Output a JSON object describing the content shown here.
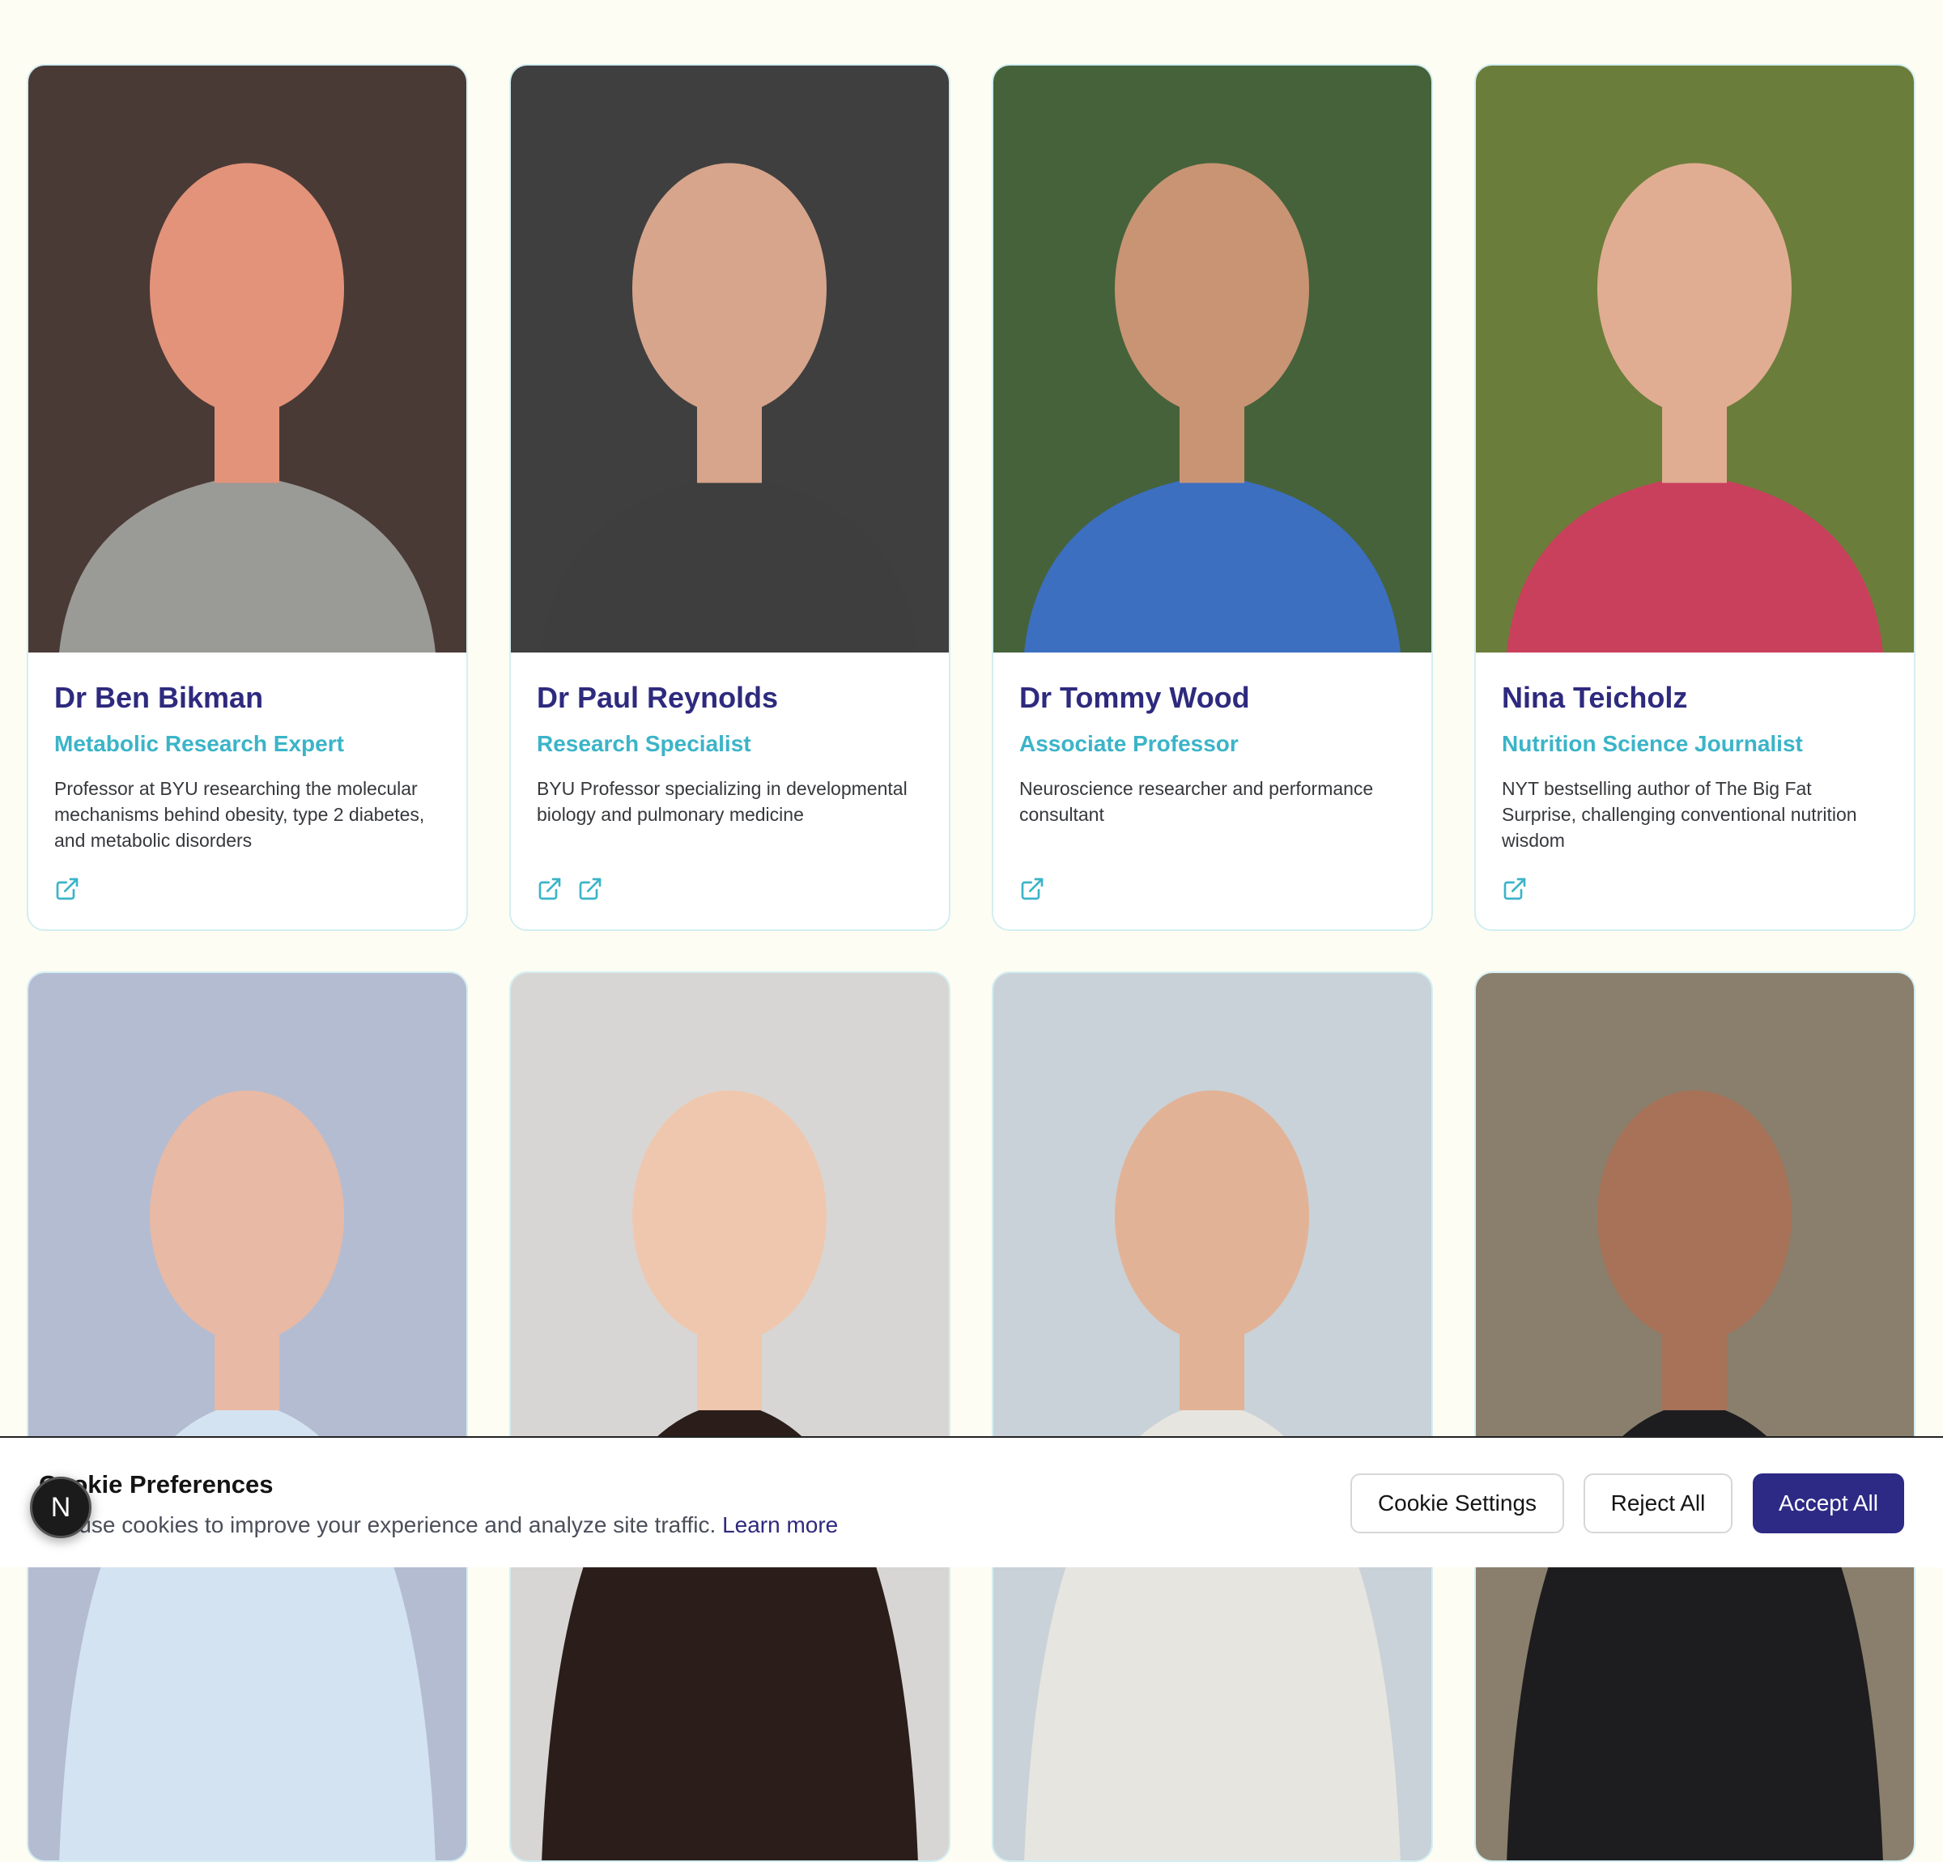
{
  "experts_row1": [
    {
      "name": "Dr Ben Bikman",
      "role": "Metabolic Research Expert",
      "desc": "Professor at BYU researching the molecular mechanisms behind obesity, type 2 diabetes, and metabolic disorders",
      "links": 1,
      "photo_colors": {
        "bg": "#4a3a36",
        "skin": "#e3937a",
        "clothes": "#9a9a96"
      }
    },
    {
      "name": "Dr Paul Reynolds",
      "role": "Research Specialist",
      "desc": "BYU Professor specializing in developmental biology and pulmonary medicine",
      "links": 2,
      "photo_colors": {
        "bg": "#3f3f3f",
        "skin": "#d7a58c",
        "clothes": "#3e3e3e"
      }
    },
    {
      "name": "Dr Tommy Wood",
      "role": "Associate Professor",
      "desc": "Neuroscience researcher and performance consultant",
      "links": 1,
      "photo_colors": {
        "bg": "#46623a",
        "skin": "#c99474",
        "clothes": "#3c6fc0"
      }
    },
    {
      "name": "Nina Teicholz",
      "role": "Nutrition Science Journalist",
      "desc": "NYT bestselling author of The Big Fat Surprise, challenging conventional nutrition wisdom",
      "links": 1,
      "photo_colors": {
        "bg": "#6b7d3a",
        "skin": "#e0ad92",
        "clothes": "#c9405c"
      }
    }
  ],
  "experts_row2": [
    {
      "photo_colors": {
        "bg": "#b4bcd2",
        "skin": "#e8b9a4",
        "clothes": "#d4e3f2"
      }
    },
    {
      "photo_colors": {
        "bg": "#d8d6d4",
        "skin": "#efc7ae",
        "clothes": "#2b1e1a"
      }
    },
    {
      "photo_colors": {
        "bg": "#c9d2d8",
        "skin": "#e2b296",
        "clothes": "#e7e5e0"
      }
    },
    {
      "photo_colors": {
        "bg": "#8a7f6c",
        "skin": "#a77258",
        "clothes": "#1d1d1f"
      }
    }
  ],
  "cookie_banner": {
    "title": "Cookie Preferences",
    "text": "We use cookies to improve your experience and analyze site traffic.",
    "link": "Learn more",
    "settings_label": "Cookie Settings",
    "reject_label": "Reject All",
    "accept_label": "Accept All"
  },
  "badge_letter": "N"
}
